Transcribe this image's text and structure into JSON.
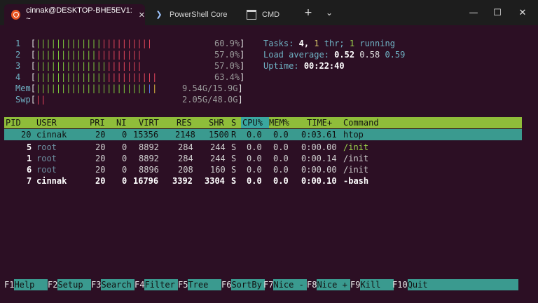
{
  "tabs": [
    {
      "label": "cinnak@DESKTOP-BHE5EV1: ~",
      "icon": "ubuntu-icon",
      "active": true
    },
    {
      "label": "PowerShell Core",
      "icon": "powershell-icon"
    },
    {
      "label": "CMD",
      "icon": "cmd-icon"
    }
  ],
  "tab_close": "✕",
  "new_tab": "+",
  "dropdown": "⌄",
  "window": {
    "minimize": "—",
    "maximize": "☐",
    "close": "✕"
  },
  "meters": {
    "cpu1": {
      "label": "1",
      "bars_green": "|||||||||||||",
      "bars_red": "||||||||||",
      "value": "60.9%"
    },
    "cpu2": {
      "label": "2",
      "bars_green": "||||||||||||",
      "bars_red": "|||||||||",
      "value": "57.0%"
    },
    "cpu3": {
      "label": "3",
      "bars_green": "||||||||||||||",
      "bars_red": "|||||||",
      "value": "57.0%"
    },
    "cpu4": {
      "label": "4",
      "bars_green": "||||||||||||||",
      "bars_red": "||||||||||",
      "value": "63.4%"
    },
    "mem": {
      "label": "Mem",
      "bars_green": "||||||||||||||||||||||",
      "bars_blue": "|",
      "bars_yellow": "|",
      "value": "9.54G/15.9G"
    },
    "swp": {
      "label": "Swp",
      "bars_red": "||",
      "value": "2.05G/48.0G"
    }
  },
  "summary": {
    "tasks_label": "Tasks:",
    "tasks": "4,",
    "threads": "1",
    "thr_label": "thr;",
    "running": "1",
    "running_label": "running",
    "load_label": "Load average:",
    "load1": "0.52",
    "load5": "0.58",
    "load15": "0.59",
    "uptime_label": "Uptime:",
    "uptime": "00:22:40"
  },
  "columns": {
    "pid": "PID",
    "user": "USER",
    "pri": "PRI",
    "ni": "NI",
    "virt": "VIRT",
    "res": "RES",
    "shr": "SHR",
    "s": "S",
    "cpu": "CPU%",
    "mem": "MEM%",
    "time": "TIME+",
    "command": "Command"
  },
  "processes": [
    {
      "pid": "20",
      "user": "cinnak",
      "pri": "20",
      "ni": "0",
      "virt": "15356",
      "res": "2148",
      "shr": "1500",
      "s": "R",
      "cpu": "0.0",
      "mem": "0.0",
      "time": "0:03.61",
      "command": "htop"
    },
    {
      "pid": "5",
      "user": "root",
      "pri": "20",
      "ni": "0",
      "virt": "8892",
      "res": "284",
      "shr": "244",
      "s": "S",
      "cpu": "0.0",
      "mem": "0.0",
      "time": "0:00.00",
      "command": "/init"
    },
    {
      "pid": "1",
      "user": "root",
      "pri": "20",
      "ni": "0",
      "virt": "8892",
      "res": "284",
      "shr": "244",
      "s": "S",
      "cpu": "0.0",
      "mem": "0.0",
      "time": "0:00.14",
      "command": "/init"
    },
    {
      "pid": "6",
      "user": "root",
      "pri": "20",
      "ni": "0",
      "virt": "8896",
      "res": "208",
      "shr": "160",
      "s": "S",
      "cpu": "0.0",
      "mem": "0.0",
      "time": "0:00.00",
      "command": "/init"
    },
    {
      "pid": "7",
      "user": "cinnak",
      "pri": "20",
      "ni": "0",
      "virt": "16796",
      "res": "3392",
      "shr": "3304",
      "s": "S",
      "cpu": "0.0",
      "mem": "0.0",
      "time": "0:00.10",
      "command": "-bash"
    }
  ],
  "fkeys": [
    {
      "key": "F1",
      "label": "Help"
    },
    {
      "key": "F2",
      "label": "Setup"
    },
    {
      "key": "F3",
      "label": "Search"
    },
    {
      "key": "F4",
      "label": "Filter"
    },
    {
      "key": "F5",
      "label": "Tree"
    },
    {
      "key": "F6",
      "label": "SortBy"
    },
    {
      "key": "F7",
      "label": "Nice -"
    },
    {
      "key": "F8",
      "label": "Nice +"
    },
    {
      "key": "F9",
      "label": "Kill"
    },
    {
      "key": "F10",
      "label": "Quit"
    }
  ],
  "colors": {
    "accent": "#8fbd3a",
    "selection": "#3a9a8f",
    "background": "#2c0f24"
  }
}
